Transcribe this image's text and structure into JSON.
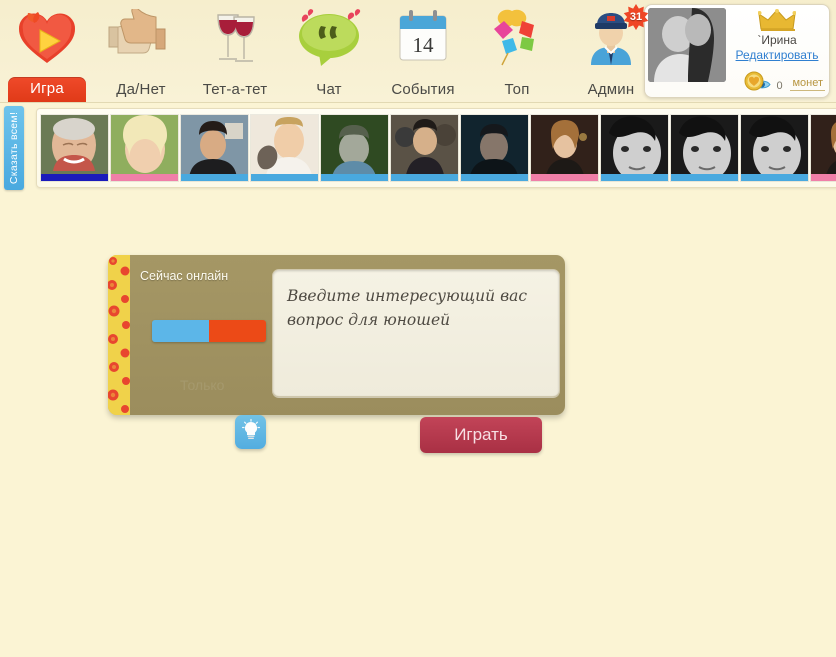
{
  "nav": {
    "items": [
      {
        "label": "Игра",
        "icon": "heart-play-icon",
        "active": true,
        "badge": null
      },
      {
        "label": "Да/Нет",
        "icon": "thumbs-updown-icon",
        "active": false,
        "badge": null
      },
      {
        "label": "Тет-а-тет",
        "icon": "wine-glasses-icon",
        "active": false,
        "badge": null
      },
      {
        "label": "Чат",
        "icon": "speech-bubble-icon",
        "active": false,
        "badge": null
      },
      {
        "label": "События",
        "icon": "calendar-icon",
        "active": false,
        "badge": null
      },
      {
        "label": "Топ",
        "icon": "stars-balloons-icon",
        "active": false,
        "badge": null
      },
      {
        "label": "Админ",
        "icon": "police-officer-icon",
        "active": false,
        "badge": "31"
      }
    ],
    "calendar_day": "14"
  },
  "profile": {
    "avatar_alt": "profile-photo",
    "crown_icon": "crown-icon",
    "name": "`Ирина",
    "edit_link": "Редактировать",
    "eye_icon": "eye-icon",
    "views": "0",
    "coin_icon": "coin-heart-icon",
    "coins": "",
    "coins_label": "монет"
  },
  "say_tab": {
    "label": "Сказать всем!"
  },
  "avatar_strip": {
    "avatars": [
      {
        "name": "avatar-1",
        "gender": "male"
      },
      {
        "name": "avatar-2",
        "gender": "female"
      },
      {
        "name": "avatar-3",
        "gender": "male"
      },
      {
        "name": "avatar-4",
        "gender": "male"
      },
      {
        "name": "avatar-5",
        "gender": "male"
      },
      {
        "name": "avatar-6",
        "gender": "male"
      },
      {
        "name": "avatar-7",
        "gender": "male"
      },
      {
        "name": "avatar-8",
        "gender": "female"
      },
      {
        "name": "avatar-9",
        "gender": "male"
      },
      {
        "name": "avatar-10",
        "gender": "male"
      },
      {
        "name": "avatar-11",
        "gender": "male"
      },
      {
        "name": "avatar-12",
        "gender": "female"
      }
    ]
  },
  "card": {
    "online_label": "Сейчас онлайн",
    "ghost_label": "Только",
    "question_placeholder": "Введите интересующий вас вопрос для юношей",
    "question_value": "",
    "hint_icon": "lightbulb-icon",
    "play_label": "Играть"
  },
  "colors": {
    "background": "#fbf4d4",
    "accent_red": "#e03a18",
    "play_button": "#b93a4e",
    "toggle_male": "#5cb6e8",
    "toggle_female": "#ec4a17",
    "link_blue": "#2f7fd0",
    "card_brown": "#9f9161"
  }
}
